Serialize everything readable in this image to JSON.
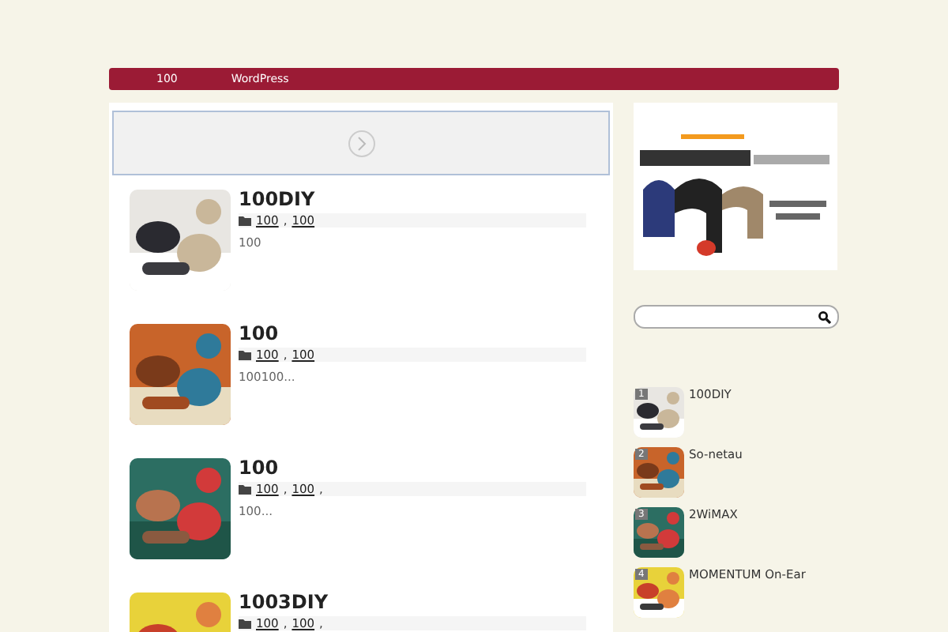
{
  "nav": {
    "items": [
      {
        "label": "100"
      },
      {
        "label": "WordPress"
      }
    ]
  },
  "posts": [
    {
      "title": "100DIY",
      "categories": [
        "100",
        "100"
      ],
      "separator": ",",
      "excerpt": "100"
    },
    {
      "title": "100",
      "categories": [
        "100",
        "100"
      ],
      "separator": ",",
      "excerpt": "100100..."
    },
    {
      "title": "100",
      "categories": [
        "100",
        "100"
      ],
      "separator": ",",
      "trail": ",",
      "excerpt": "100..."
    },
    {
      "title": "1003DIY",
      "categories": [
        "100",
        "100"
      ],
      "separator": ",",
      "trail": ","
    }
  ],
  "sidebar": {
    "popular": [
      {
        "rank": "1",
        "title": "100DIY"
      },
      {
        "rank": "2",
        "title": "So-netau"
      },
      {
        "rank": "3",
        "title": "2WiMAX"
      },
      {
        "rank": "4",
        "title": "MOMENTUM On-Ear"
      }
    ]
  }
}
